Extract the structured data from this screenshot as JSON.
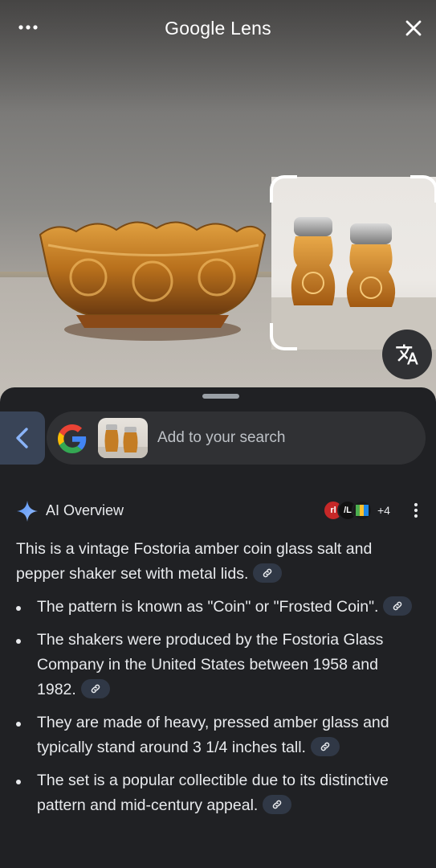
{
  "app": {
    "title": "Google Lens"
  },
  "top_bar": {
    "more_icon": "more-horiz-icon",
    "close_icon": "close-icon"
  },
  "image_actions": {
    "translate_icon": "translate-icon"
  },
  "search": {
    "placeholder": "Add to your search",
    "back_icon": "chevron-left-icon"
  },
  "ai_overview": {
    "title": "AI Overview",
    "sources_more": "+4",
    "source_badges": [
      "rl",
      "/L",
      ""
    ],
    "summary": "This is a vintage Fostoria amber coin glass salt and pepper shaker set with metal lids.",
    "bullets": [
      "The pattern is known as \"Coin\" or \"Frosted Coin\".",
      "The shakers were produced by the Fostoria Glass Company in the United States between 1958 and 1982.",
      "They are made of heavy, pressed amber glass and typically stand around 3 1/4 inches tall.",
      "The set is a popular collectible due to its distinctive pattern and mid-century appeal."
    ]
  },
  "colors": {
    "sheet_bg": "#202124",
    "pill_bg": "#303134",
    "back_bg": "#394457",
    "accent_blue": "#8ab4f8"
  }
}
